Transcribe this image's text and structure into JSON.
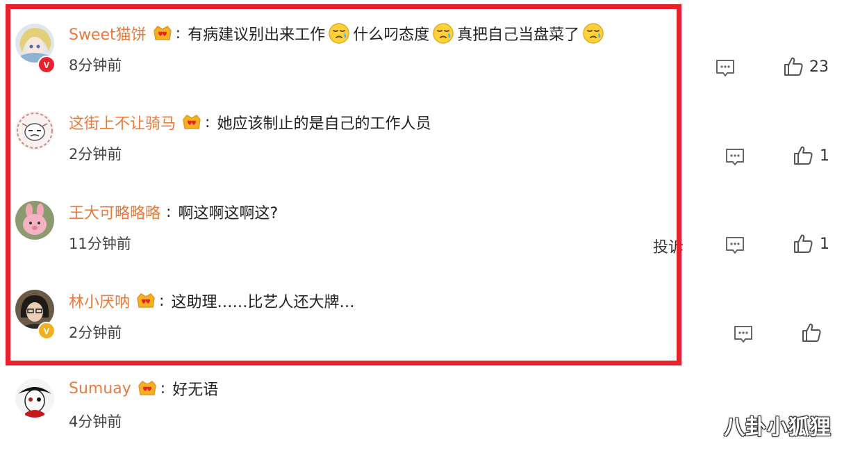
{
  "comments": [
    {
      "username": "Sweet猫饼",
      "text_parts": [
        "有病建议别出来工作",
        "什么叼态度",
        "真把自己当盘菜了"
      ],
      "time": "8分钟前",
      "like_count": "23",
      "avatar_icon": "avatar-anime-girl",
      "badge": "V",
      "badge_color": "#e8222b"
    },
    {
      "username": "这街上不让骑马",
      "text": "她应该制止的是自己的工作人员",
      "time": "2分钟前",
      "like_count": "1",
      "avatar_icon": "avatar-sketch-face"
    },
    {
      "username": "王大可略略略",
      "text": "啊这啊这啊这?",
      "time": "11分钟前",
      "like_count": "1",
      "avatar_icon": "avatar-pink-rabbit"
    },
    {
      "username": "林小厌呐",
      "text": "这助理……比艺人还大牌…",
      "time": "2分钟前",
      "like_count": "",
      "avatar_icon": "avatar-person-glasses",
      "badge": "V",
      "badge_color": "#f2b01e"
    },
    {
      "username": "Sumuay",
      "text": "好无语",
      "time": "4分钟前",
      "avatar_icon": "avatar-mask-figure"
    }
  ],
  "report_label": "投诉",
  "watermark": "八卦小狐狸",
  "colors": {
    "highlight_border": "#e8222b",
    "username": "#e87a3d",
    "background": "#ffffff"
  },
  "icons": {
    "comment": "comment-icon",
    "like": "thumbs-up-icon",
    "vip": "vip-crown-icon",
    "emoji": "sad-sweat-emoji-icon"
  }
}
